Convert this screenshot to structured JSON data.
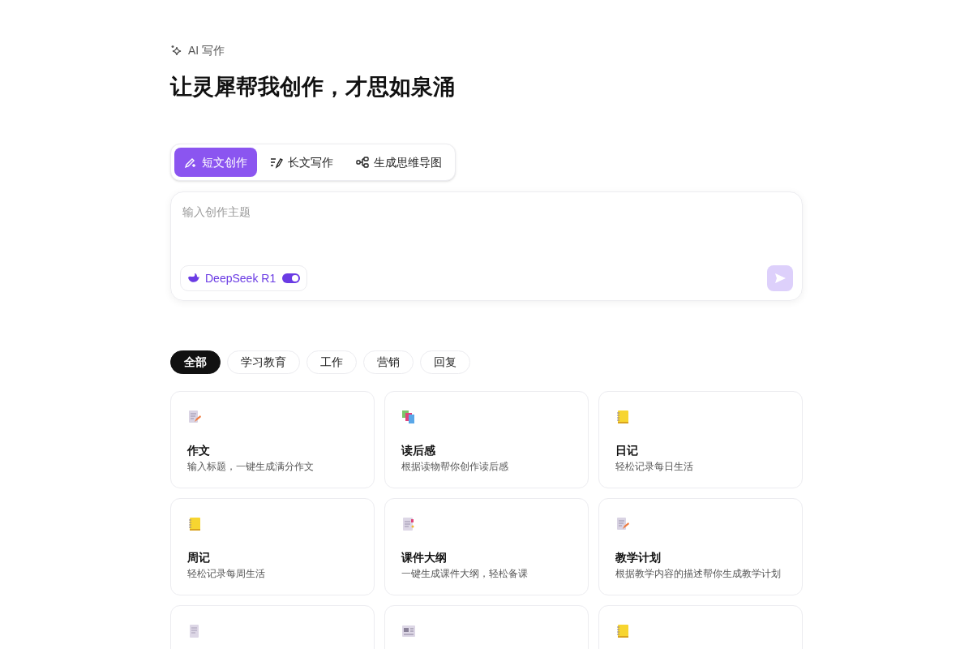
{
  "header": {
    "label": "AI 写作",
    "title": "让灵犀帮我创作，才思如泉涌"
  },
  "modes": [
    {
      "label": "短文创作",
      "kind": "pen",
      "selected": true
    },
    {
      "label": "长文写作",
      "kind": "lines",
      "selected": false
    },
    {
      "label": "生成思维导图",
      "kind": "mindmap",
      "selected": false
    }
  ],
  "prompt": {
    "placeholder": "输入创作主题",
    "model": {
      "label": "DeepSeek R1",
      "on": true
    },
    "send": {
      "disabled": true
    }
  },
  "categories": [
    {
      "label": "全部",
      "selected": true
    },
    {
      "label": "学习教育",
      "selected": false
    },
    {
      "label": "工作",
      "selected": false
    },
    {
      "label": "营销",
      "selected": false
    },
    {
      "label": "回复",
      "selected": false
    }
  ],
  "cards": [
    {
      "kind": "pencil-doc",
      "title": "作文",
      "desc": "输入标题，一键生成满分作文"
    },
    {
      "kind": "books",
      "title": "读后感",
      "desc": "根据读物帮你创作读后感"
    },
    {
      "kind": "notebook",
      "title": "日记",
      "desc": "轻松记录每日生活"
    },
    {
      "kind": "notebook",
      "title": "周记",
      "desc": "轻松记录每周生活"
    },
    {
      "kind": "bookmark-doc",
      "title": "课件大纲",
      "desc": "一键生成课件大纲，轻松备课"
    },
    {
      "kind": "pencil-doc",
      "title": "教学计划",
      "desc": "根据教学内容的描述帮你生成教学计划"
    },
    {
      "kind": "scroll"
    },
    {
      "kind": "newspaper"
    },
    {
      "kind": "notebook"
    }
  ]
}
